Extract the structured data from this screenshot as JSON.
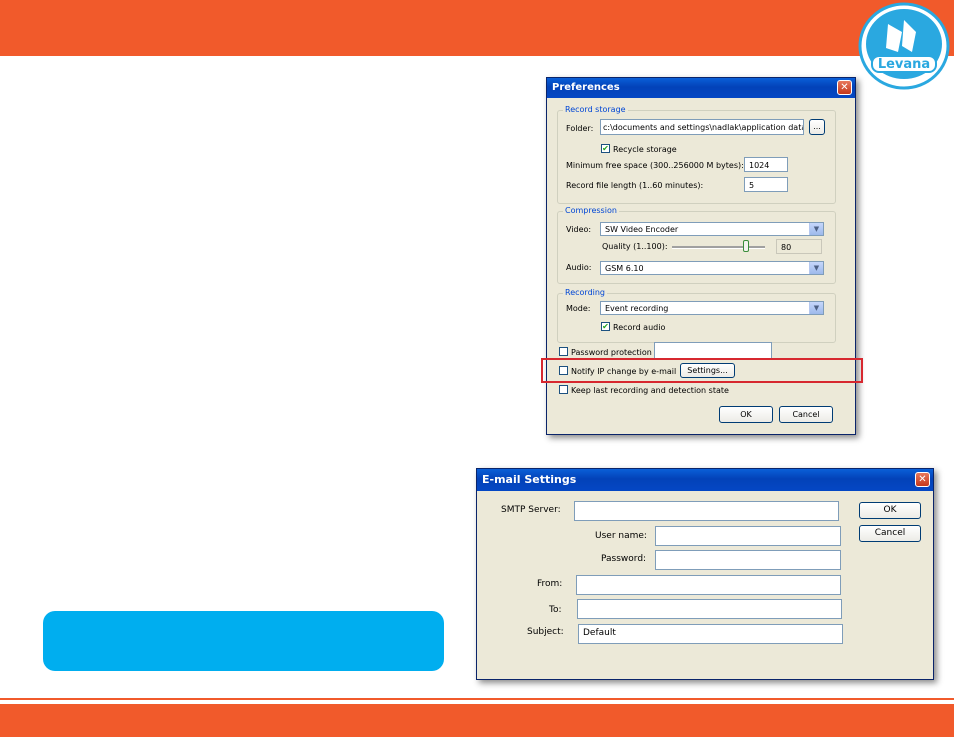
{
  "brand": {
    "logo_text": "Levana",
    "band_color": "#f15a2b",
    "accent_blue": "#00aeef"
  },
  "preferences": {
    "title": "Preferences",
    "record_storage": {
      "legend": "Record storage",
      "folder_label": "Folder:",
      "folder_value": "c:\\documents and settings\\nadlak\\application data\\sec...",
      "browse_label": "...",
      "recycle_label": "Recycle storage",
      "recycle_checked": true,
      "min_free_label": "Minimum free space (300..256000 M bytes):",
      "min_free_value": "1024",
      "file_length_label": "Record file length (1..60 minutes):",
      "file_length_value": "5"
    },
    "compression": {
      "legend": "Compression",
      "video_label": "Video:",
      "video_value": "SW Video Encoder",
      "quality_label": "Quality (1..100):",
      "quality_value": "80",
      "quality_level": 80,
      "audio_label": "Audio:",
      "audio_value": "GSM 6.10"
    },
    "recording": {
      "legend": "Recording",
      "mode_label": "Mode:",
      "mode_value": "Event recording",
      "record_audio_label": "Record audio",
      "record_audio_checked": true
    },
    "password_label": "Password protection",
    "notify_label": "Notify IP change by e-mail",
    "settings_button": "Settings...",
    "keep_last_label": "Keep last recording and detection state",
    "ok_button": "OK",
    "cancel_button": "Cancel"
  },
  "email_settings": {
    "title": "E-mail Settings",
    "smtp_label": "SMTP Server:",
    "smtp_value": "",
    "user_label": "User name:",
    "user_value": "",
    "password_label": "Password:",
    "password_value": "",
    "from_label": "From:",
    "from_value": "",
    "to_label": "To:",
    "to_value": "",
    "subject_label": "Subject:",
    "subject_value": "Default",
    "ok_button": "OK",
    "cancel_button": "Cancel"
  }
}
